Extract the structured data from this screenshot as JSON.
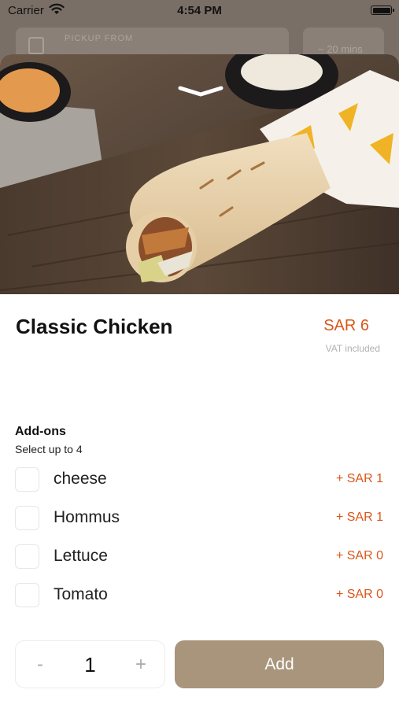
{
  "status_bar": {
    "carrier": "Carrier",
    "time": "4:54 PM"
  },
  "background": {
    "pickup_label": "PICKUP FROM",
    "eta": "~ 20 mins"
  },
  "product": {
    "name": "Classic Chicken",
    "price": "SAR 6",
    "vat_note": "VAT included"
  },
  "addons": {
    "title": "Add-ons",
    "subtitle": "Select up to 4",
    "items": [
      {
        "label": "cheese",
        "price": "+  SAR 1"
      },
      {
        "label": "Hommus",
        "price": "+  SAR 1"
      },
      {
        "label": "Lettuce",
        "price": "+  SAR 0"
      },
      {
        "label": "Tomato",
        "price": "+  SAR 0"
      }
    ]
  },
  "quantity": {
    "minus": "-",
    "value": "1",
    "plus": "+"
  },
  "actions": {
    "add_label": "Add"
  },
  "colors": {
    "accent": "#d9571a",
    "add_button": "#a8957b"
  }
}
